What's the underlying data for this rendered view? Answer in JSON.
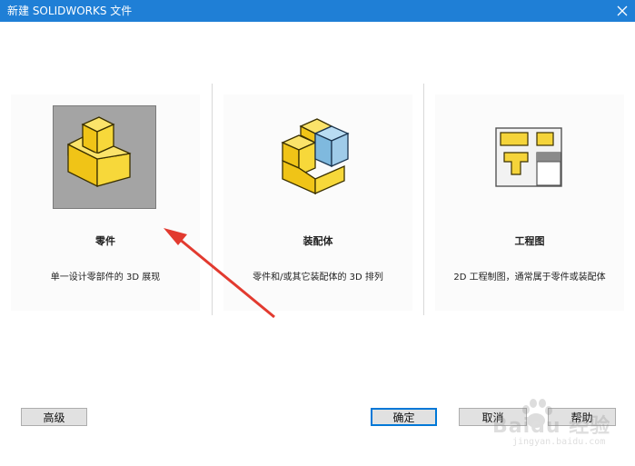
{
  "window": {
    "title": "新建 SOLIDWORKS 文件"
  },
  "panels": [
    {
      "name": "零件",
      "description": "单一设计零部件的 3D 展现",
      "icon": "part-icon",
      "selected": true
    },
    {
      "name": "装配体",
      "description": "零件和/或其它装配体的 3D 排列",
      "icon": "assembly-icon",
      "selected": false
    },
    {
      "name": "工程图",
      "description": "2D 工程制图，通常属于零件或装配体",
      "icon": "drawing-icon",
      "selected": false
    }
  ],
  "buttons": {
    "advanced": "高级",
    "ok": "确定",
    "cancel": "取消",
    "help": "帮助"
  },
  "watermark": {
    "brand": "Baidu 经验",
    "url": "jingyan.baidu.com"
  },
  "colors": {
    "titlebar": "#1f7fd6",
    "part_yellow": "#f5d43a",
    "assembly_blue": "#8cc4e6",
    "arrow_red": "#e23a2f",
    "default_button_border": "#0078d7"
  }
}
